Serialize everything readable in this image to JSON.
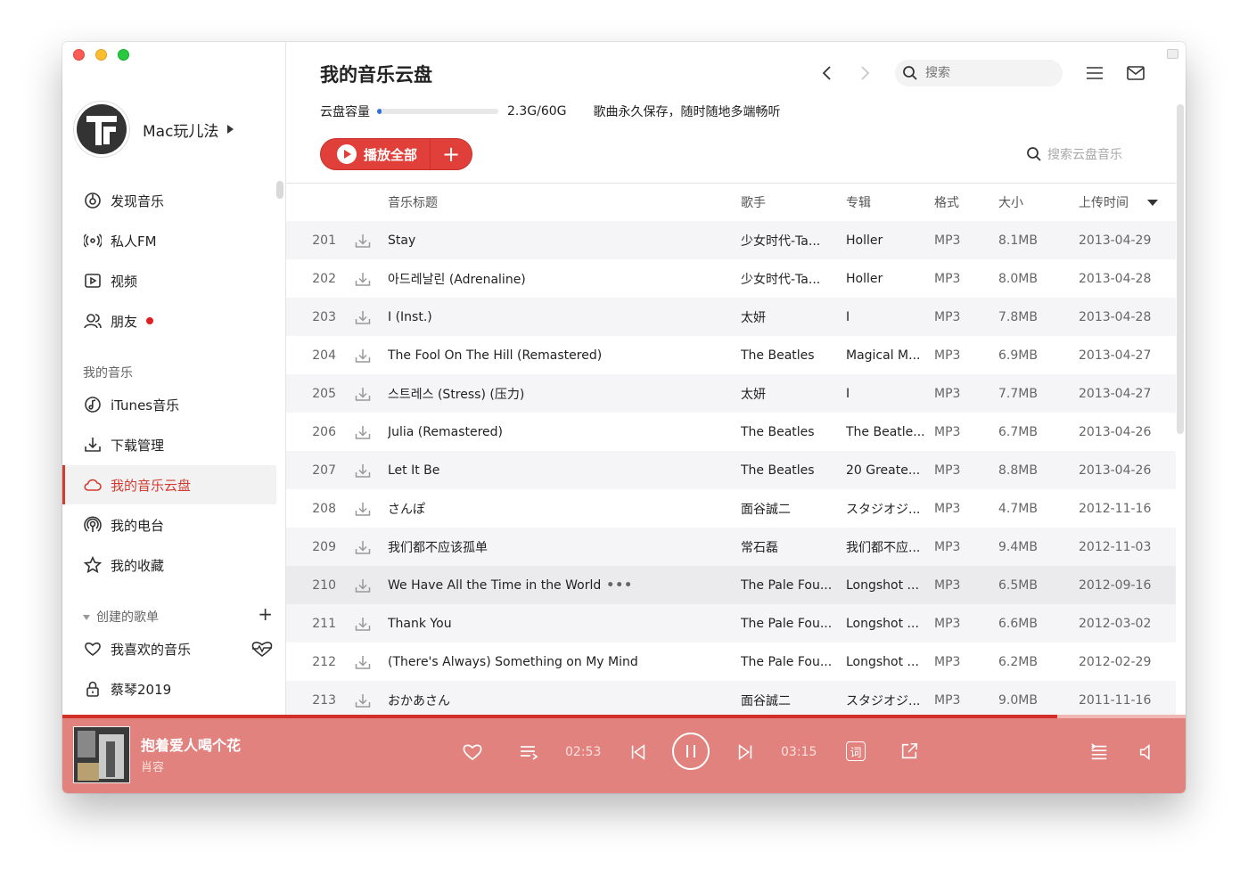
{
  "sidebar": {
    "username": "Mac玩儿法",
    "nav": [
      {
        "label": "发现音乐",
        "icon": "discover-music-icon"
      },
      {
        "label": "私人FM",
        "icon": "radio-fm-icon"
      },
      {
        "label": "视频",
        "icon": "video-icon"
      },
      {
        "label": "朋友",
        "icon": "friends-icon"
      }
    ],
    "my_music_title": "我的音乐",
    "my_music": [
      {
        "label": "iTunes音乐",
        "icon": "itunes-music-icon"
      },
      {
        "label": "下载管理",
        "icon": "download-icon"
      },
      {
        "label": "我的音乐云盘",
        "icon": "cloud-icon"
      },
      {
        "label": "我的电台",
        "icon": "podcast-icon"
      },
      {
        "label": "我的收藏",
        "icon": "star-icon"
      }
    ],
    "playlists_title": "创建的歌单",
    "playlists": [
      {
        "label": "我喜欢的音乐",
        "icon": "heart-icon"
      },
      {
        "label": "蔡琴2019",
        "icon": "lock-icon"
      }
    ]
  },
  "main": {
    "title": "我的音乐云盘",
    "search_placeholder": "搜索",
    "capacity_label": "云盘容量",
    "capacity_value": "2.3G/60G",
    "capacity_fraction": 0.038,
    "capacity_desc": "歌曲永久保存，随时随地多端畅听",
    "play_all_label": "播放全部",
    "add_label": "+",
    "cloud_search_placeholder": "搜索云盘音乐",
    "columns": {
      "title": "音乐标题",
      "artist": "歌手",
      "album": "专辑",
      "format": "格式",
      "size": "大小",
      "date": "上传时间"
    },
    "rows": [
      {
        "idx": "201",
        "title": "Stay",
        "artist": "少女时代-Ta...",
        "album": "Holler",
        "format": "MP3",
        "size": "8.1MB",
        "date": "2013-04-29"
      },
      {
        "idx": "202",
        "title": "아드레날린 (Adrenaline)",
        "artist": "少女时代-Ta...",
        "album": "Holler",
        "format": "MP3",
        "size": "8.0MB",
        "date": "2013-04-28"
      },
      {
        "idx": "203",
        "title": "I (Inst.)",
        "artist": "太妍",
        "album": "I",
        "format": "MP3",
        "size": "7.8MB",
        "date": "2013-04-28"
      },
      {
        "idx": "204",
        "title": "The Fool On The Hill (Remastered)",
        "artist": "The Beatles",
        "album": "Magical M...",
        "format": "MP3",
        "size": "6.9MB",
        "date": "2013-04-27"
      },
      {
        "idx": "205",
        "title": "스트레스 (Stress) (压力)",
        "artist": "太妍",
        "album": "I",
        "format": "MP3",
        "size": "7.7MB",
        "date": "2013-04-27"
      },
      {
        "idx": "206",
        "title": "Julia (Remastered)",
        "artist": "The Beatles",
        "album": "The Beatle...",
        "format": "MP3",
        "size": "6.7MB",
        "date": "2013-04-26"
      },
      {
        "idx": "207",
        "title": "Let It Be",
        "artist": "The Beatles",
        "album": "20 Greate...",
        "format": "MP3",
        "size": "8.8MB",
        "date": "2013-04-26"
      },
      {
        "idx": "208",
        "title": "さんぽ",
        "artist": "面谷誠二",
        "album": "スタジオジ...",
        "format": "MP3",
        "size": "4.7MB",
        "date": "2012-11-16"
      },
      {
        "idx": "209",
        "title": "我们都不应该孤单",
        "artist": "常石磊",
        "album": "我们都不应...",
        "format": "MP3",
        "size": "9.4MB",
        "date": "2012-11-03"
      },
      {
        "idx": "210",
        "title": "We Have All the Time in the World",
        "more": "•••",
        "artist": "The Pale Fou...",
        "album": "Longshot ...",
        "format": "MP3",
        "size": "6.5MB",
        "date": "2012-09-16"
      },
      {
        "idx": "211",
        "title": "Thank You",
        "artist": "The Pale Fou...",
        "album": "Longshot ...",
        "format": "MP3",
        "size": "6.6MB",
        "date": "2012-03-02"
      },
      {
        "idx": "212",
        "title": "(There's Always) Something on My Mind",
        "artist": "The Pale Fou...",
        "album": "Longshot ...",
        "format": "MP3",
        "size": "6.2MB",
        "date": "2012-02-29"
      },
      {
        "idx": "213",
        "title": "おかあさん",
        "artist": "面谷誠二",
        "album": "スタジオジ...",
        "format": "MP3",
        "size": "9.0MB",
        "date": "2011-11-16"
      }
    ]
  },
  "player": {
    "song_title": "抱着爱人喝个花",
    "artist": "肖容",
    "current_time": "02:53",
    "total_time": "03:15",
    "progress_fraction": 0.886,
    "lyric_label": "词",
    "accent_color": "#e2827e"
  }
}
